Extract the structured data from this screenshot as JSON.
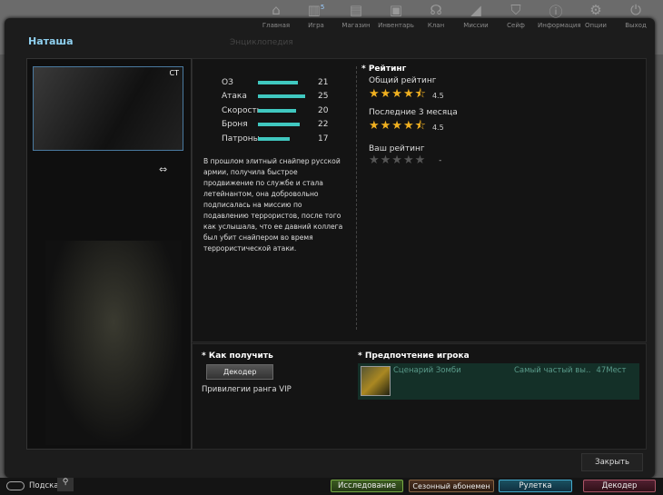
{
  "topnav": [
    "Главная",
    "Игра",
    "Магазин",
    "Инвентарь",
    "Клан",
    "Миссии",
    "Сейф",
    "Информация",
    "Опции",
    "Выход"
  ],
  "topnav_badge": "5",
  "background_label": "Энциклопедия",
  "window": {
    "title": "Наташа",
    "class_badge": "CT"
  },
  "stats": [
    {
      "label": "ОЗ",
      "value": "21",
      "pct": 84
    },
    {
      "label": "Атака",
      "value": "25",
      "pct": 100
    },
    {
      "label": "Скорость",
      "value": "20",
      "pct": 80
    },
    {
      "label": "Броня",
      "value": "22",
      "pct": 88
    },
    {
      "label": "Патроны",
      "value": "17",
      "pct": 68
    }
  ],
  "description": "В прошлом элитный снайпер русской армии, получила быстрое продвижение по службе и стала летейнантом, она добровольно подписалась на миссию по подавлению террористов, после того как услышала, что ее давний коллега был убит снайпером во время террористической атаки.",
  "rating": {
    "header": "* Рейтинг",
    "overall_label": "Общий рейтинг",
    "overall_value": "4.5",
    "recent_label": "Последние 3 месяца",
    "recent_value": "4.5",
    "your_label": "Ваш рейтинг",
    "your_value": "-"
  },
  "how_to_get": {
    "header": "* Как получить",
    "button": "Декодер",
    "note": "Привилегии ранга VIP"
  },
  "preference": {
    "header": "* Предпочтение игрока",
    "mode": "Сценарий Зомби",
    "stat": "Самый частый вы..",
    "place": "47Мест"
  },
  "close_label": "Закрыть",
  "footer": {
    "search_label": "Подска",
    "buttons": [
      "Исследование",
      "Сезонный абонемен",
      "Рулетка",
      "Декодер"
    ]
  }
}
